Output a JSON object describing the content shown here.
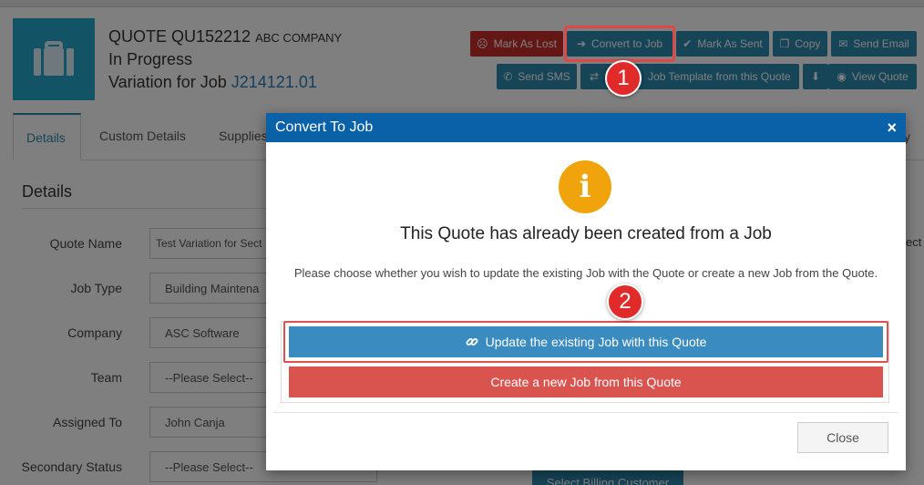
{
  "header": {
    "quote_label": "QUOTE QU152212",
    "company": "ABC COMPANY",
    "status": "In Progress",
    "variation_prefix": "Variation for Job",
    "variation_job": "J214121.01"
  },
  "toolbar": {
    "mark_lost": "Mark As Lost",
    "convert_to_job": "Convert to Job",
    "mark_sent": "Mark As Sent",
    "copy": "Copy",
    "send_email": "Send Email",
    "send_sms": "Send SMS",
    "job_template": "Job Template from this Quote",
    "view_quote": "View Quote"
  },
  "tabs": [
    "Details",
    "Custom Details",
    "Supplies"
  ],
  "tab_right_fragment": "y",
  "details": {
    "section_title": "Details",
    "fields": [
      {
        "label": "Quote Name",
        "value": "Test Variation for Sect"
      },
      {
        "label": "Job Type",
        "value": "Building Maintena"
      },
      {
        "label": "Company",
        "value": "ASC Software"
      },
      {
        "label": "Team",
        "value": "--Please Select--"
      },
      {
        "label": "Assigned To",
        "value": "John Canja"
      },
      {
        "label": "Secondary Status",
        "value": "--Please Select--"
      }
    ],
    "billing_button": "Select Billing Customer",
    "right_fragment": "ect"
  },
  "modal": {
    "title": "Convert To Job",
    "close_glyph": "×",
    "info_glyph": "i",
    "heading": "This Quote has already been created from a Job",
    "message": "Please choose whether you wish to update the existing Job with the Quote or create a new Job from the Quote.",
    "update_button": "Update the existing Job with this Quote",
    "create_button": "Create a new Job from this Quote",
    "close_button": "Close"
  },
  "callouts": [
    "1",
    "2"
  ],
  "colors": {
    "accent": "#2d8ab0",
    "modal_header": "#0a61a7",
    "danger": "#d9534f",
    "info": "#f0a30a",
    "highlight": "#e04848"
  },
  "icons": {
    "tile": "briefcase-icon",
    "update": "link-icon"
  }
}
